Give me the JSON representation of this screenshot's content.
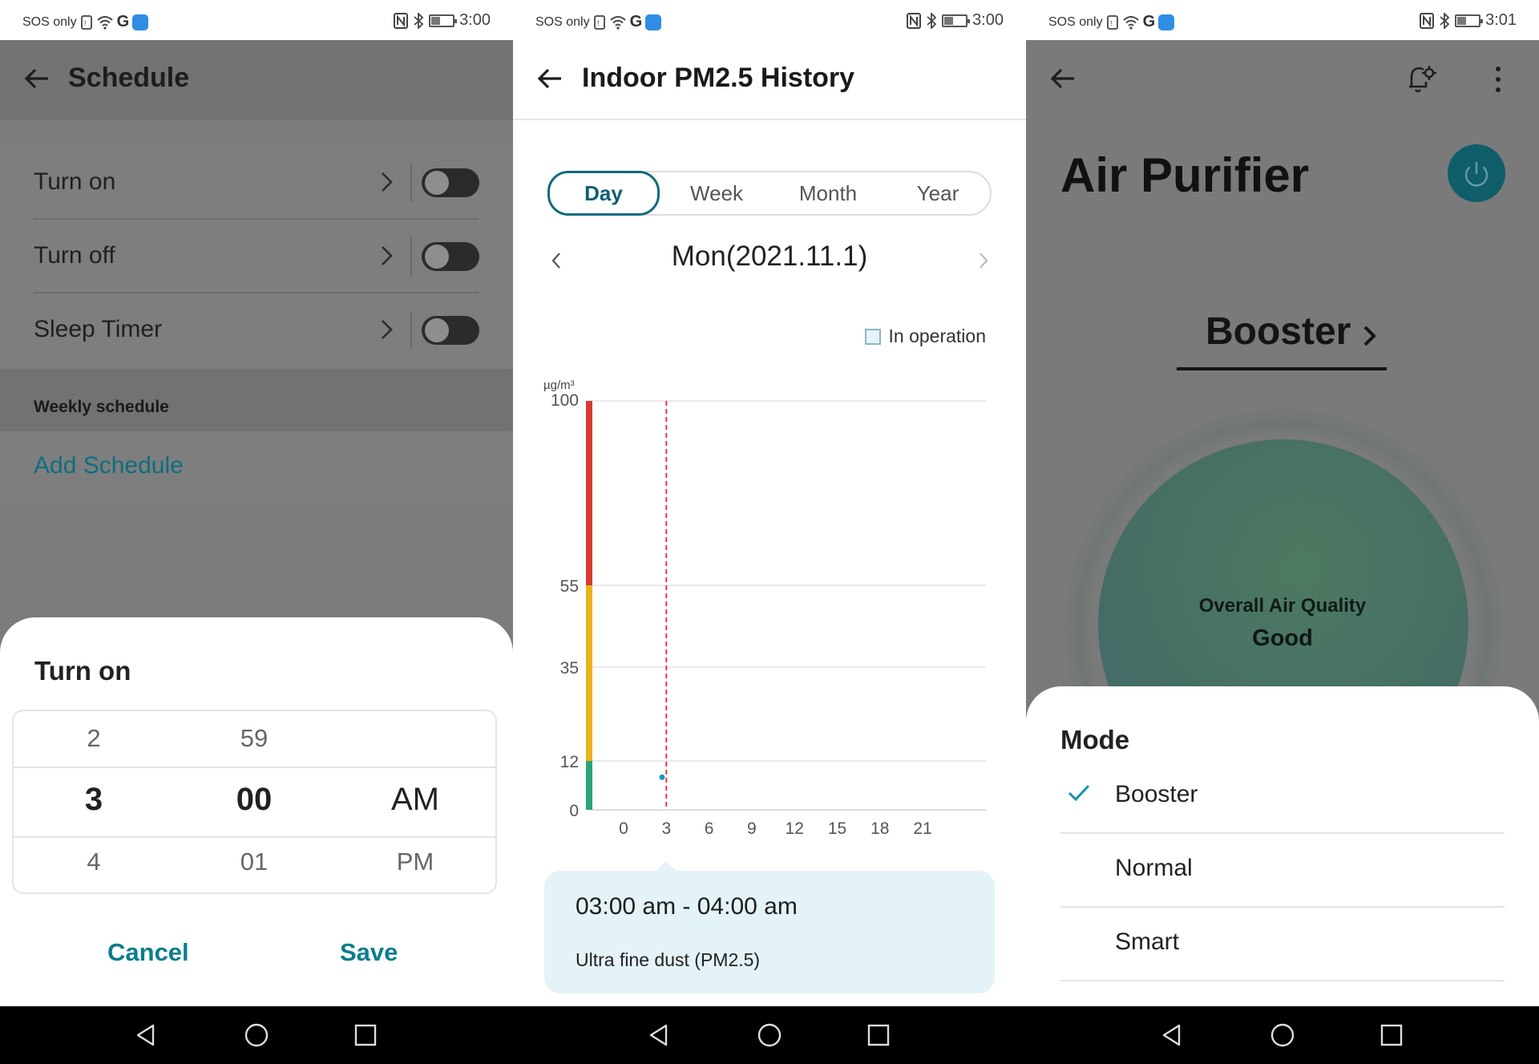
{
  "status_bars": [
    {
      "left": "SOS only",
      "time": "3:00"
    },
    {
      "left": "SOS only",
      "time": "3:00"
    },
    {
      "left": "SOS only",
      "time": "3:01"
    }
  ],
  "schedule": {
    "title": "Schedule",
    "rows": [
      {
        "label": "Turn on",
        "enabled": false
      },
      {
        "label": "Turn off",
        "enabled": false
      },
      {
        "label": "Sleep Timer",
        "enabled": false
      }
    ],
    "weekly_header": "Weekly schedule",
    "add_link": "Add Schedule",
    "sheet": {
      "title": "Turn on",
      "hours": [
        "2",
        "3",
        "4"
      ],
      "minutes": [
        "59",
        "00",
        "01"
      ],
      "ampm": [
        "AM",
        "PM"
      ],
      "cancel": "Cancel",
      "save": "Save"
    }
  },
  "history": {
    "title": "Indoor PM2.5 History",
    "tabs": [
      "Day",
      "Week",
      "Month",
      "Year"
    ],
    "selected_tab": "Day",
    "date": "Mon(2021.11.1)",
    "legend": "In operation",
    "unit": "µg/m³",
    "tooltip": {
      "range": "03:00 am - 04:00 am",
      "label": "Ultra fine dust (PM2.5)"
    }
  },
  "chart_data": {
    "type": "scatter",
    "title": "",
    "xlabel": "",
    "ylabel": "µg/m³",
    "x_ticks": [
      "0",
      "3",
      "6",
      "9",
      "12",
      "15",
      "18",
      "21"
    ],
    "y_ticks": [
      "0",
      "12",
      "35",
      "55",
      "100"
    ],
    "xlim": [
      -1,
      24
    ],
    "ylim": [
      0,
      100
    ],
    "grid": true,
    "series": [
      {
        "values": [
          {
            "x": 2.7,
            "y": 8
          }
        ]
      }
    ],
    "selected_hour": 3,
    "level_bands": [
      {
        "from": 0,
        "to": 12,
        "color": "#2aa57a"
      },
      {
        "from": 12,
        "to": 55,
        "color": "#eab21b"
      },
      {
        "from": 55,
        "to": 100,
        "color": "#d93a2f"
      }
    ],
    "colors": {
      "point": "#1597c4",
      "marker": "#d94040",
      "grid": "#e4e4e4"
    }
  },
  "purifier": {
    "title": "Air Purifier",
    "current_mode": "Booster",
    "quality_label": "Overall Air Quality",
    "quality_value": "Good",
    "sheet": {
      "title": "Mode",
      "options": [
        {
          "label": "Booster",
          "selected": true
        },
        {
          "label": "Normal",
          "selected": false
        },
        {
          "label": "Smart",
          "selected": false
        }
      ]
    },
    "colors": {
      "accent": "#0f8ba0",
      "power": "#0f5e6a"
    }
  }
}
